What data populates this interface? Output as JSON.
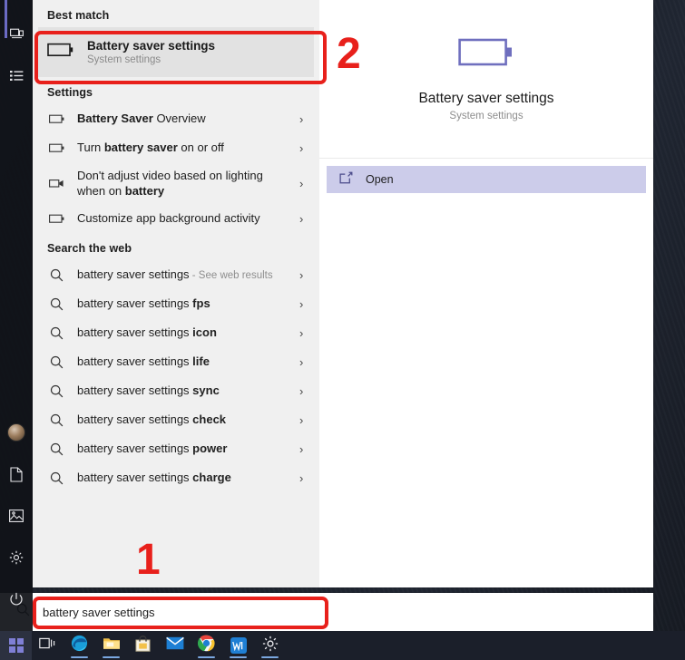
{
  "search": {
    "value": "battery saver settings",
    "icon": "search-icon"
  },
  "left_pane": {
    "best_match_header": "Best match",
    "best_match": {
      "title": "Battery saver settings",
      "subtitle": "System settings",
      "icon": "battery-icon"
    },
    "settings_header": "Settings",
    "settings_items": [
      {
        "icon": "battery-icon",
        "pre": "",
        "bold": "Battery Saver",
        "post": " Overview",
        "chevron": "›"
      },
      {
        "icon": "battery-icon",
        "pre": "Turn ",
        "bold": "battery saver",
        "post": " on or off",
        "chevron": "›"
      },
      {
        "icon": "video-camera-icon",
        "pre": "Don't adjust video based on lighting when on ",
        "bold": "battery",
        "post": "",
        "chevron": "›"
      },
      {
        "icon": "battery-icon",
        "pre": "Customize app background activity",
        "bold": "",
        "post": "",
        "chevron": "›"
      }
    ],
    "web_header": "Search the web",
    "web_items": [
      {
        "icon": "search-icon",
        "text": "battery saver settings",
        "bold": "",
        "dim": " - See web results",
        "chevron": "›"
      },
      {
        "icon": "search-icon",
        "text": "battery saver settings ",
        "bold": "fps",
        "dim": "",
        "chevron": "›"
      },
      {
        "icon": "search-icon",
        "text": "battery saver settings ",
        "bold": "icon",
        "dim": "",
        "chevron": "›"
      },
      {
        "icon": "search-icon",
        "text": "battery saver settings ",
        "bold": "life",
        "dim": "",
        "chevron": "›"
      },
      {
        "icon": "search-icon",
        "text": "battery saver settings ",
        "bold": "sync",
        "dim": "",
        "chevron": "›"
      },
      {
        "icon": "search-icon",
        "text": "battery saver settings ",
        "bold": "check",
        "dim": "",
        "chevron": "›"
      },
      {
        "icon": "search-icon",
        "text": "battery saver settings ",
        "bold": "power",
        "dim": "",
        "chevron": "›"
      },
      {
        "icon": "search-icon",
        "text": "battery saver settings ",
        "bold": "charge",
        "dim": "",
        "chevron": "›"
      }
    ]
  },
  "right_pane": {
    "icon": "battery-icon",
    "title": "Battery saver settings",
    "subtitle": "System settings",
    "open_label": "Open",
    "open_icon": "open-external-icon"
  },
  "annotations": [
    {
      "label": "1",
      "target": "search-box"
    },
    {
      "label": "2",
      "target": "best-match-row"
    }
  ],
  "start_rail": {
    "items": [
      {
        "icon": "media-photo-icon"
      },
      {
        "icon": "list-icon"
      },
      {
        "icon": "user-avatar-icon"
      },
      {
        "icon": "document-icon"
      },
      {
        "icon": "pictures-icon"
      },
      {
        "icon": "gear-icon"
      },
      {
        "icon": "power-icon"
      }
    ]
  },
  "taskbar": {
    "items": [
      {
        "icon": "windows-start-icon",
        "name": "start-button"
      },
      {
        "icon": "task-view-icon",
        "name": "task-view-button"
      },
      {
        "icon": "edge-icon",
        "name": "edge-button"
      },
      {
        "icon": "file-explorer-icon",
        "name": "file-explorer-button"
      },
      {
        "icon": "microsoft-store-icon",
        "name": "store-button"
      },
      {
        "icon": "mail-icon",
        "name": "mail-button"
      },
      {
        "icon": "chrome-icon",
        "name": "chrome-button"
      },
      {
        "icon": "wps-office-icon",
        "name": "wps-button"
      },
      {
        "icon": "gear-icon",
        "name": "settings-button"
      }
    ]
  },
  "colors": {
    "accent_red": "#e8201b",
    "highlight_lavender": "#ccccea",
    "best_match_gray": "#e2e2e2",
    "left_pane_bg": "#f0f0f0"
  }
}
